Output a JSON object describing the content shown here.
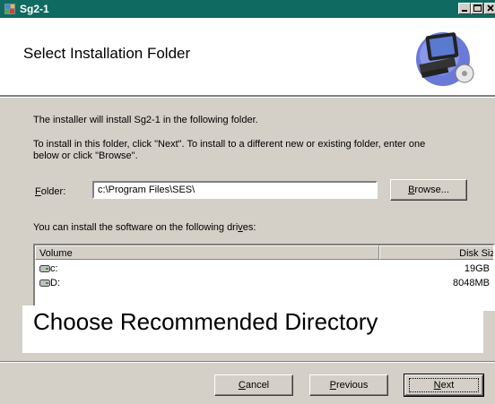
{
  "window": {
    "title": "Sg2-1",
    "title_color": "#0f6b61"
  },
  "header": {
    "heading": "Select Installation Folder",
    "art": "computer-install-icon"
  },
  "body": {
    "intro": "The installer will install Sg2-1 in the following folder.",
    "instructions_line1": "To install in this folder, click \"Next\". To install to a different new or existing folder, enter one",
    "instructions_line2": "below or click \"Browse\".",
    "folder_label": "Folder:",
    "folder_label_hotkey": "F",
    "folder_label_rest": "older:",
    "folder_value": "c:\\Program Files\\SES\\",
    "browse_hotkey": "B",
    "browse_rest": "rowse...",
    "drives_text_before": "You can install the software on the following dri",
    "drives_text_hotkey": "v",
    "drives_text_after": "es:"
  },
  "drives": {
    "columns": [
      "Volume",
      "Disk Size"
    ],
    "rows": [
      {
        "volume": "c:",
        "size": "19GB"
      },
      {
        "volume": "D:",
        "size": "8048MB"
      }
    ]
  },
  "caption": "Choose Recommended Directory",
  "buttons": {
    "cancel_hotkey": "C",
    "cancel_rest": "ancel",
    "previous_hotkey": "P",
    "previous_rest": "revious",
    "next_hotkey": "N",
    "next_rest": "ext"
  }
}
